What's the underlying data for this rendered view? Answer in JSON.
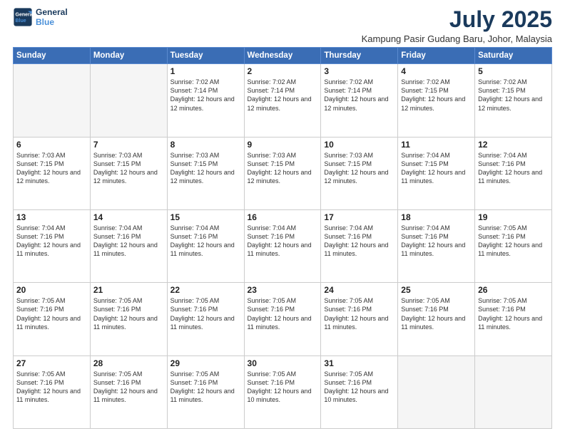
{
  "logo": {
    "line1": "General",
    "line2": "Blue"
  },
  "header": {
    "month_year": "July 2025",
    "location": "Kampung Pasir Gudang Baru, Johor, Malaysia"
  },
  "days_of_week": [
    "Sunday",
    "Monday",
    "Tuesday",
    "Wednesday",
    "Thursday",
    "Friday",
    "Saturday"
  ],
  "weeks": [
    [
      {
        "day": "",
        "info": ""
      },
      {
        "day": "",
        "info": ""
      },
      {
        "day": "1",
        "info": "Sunrise: 7:02 AM\nSunset: 7:14 PM\nDaylight: 12 hours and 12 minutes."
      },
      {
        "day": "2",
        "info": "Sunrise: 7:02 AM\nSunset: 7:14 PM\nDaylight: 12 hours and 12 minutes."
      },
      {
        "day": "3",
        "info": "Sunrise: 7:02 AM\nSunset: 7:14 PM\nDaylight: 12 hours and 12 minutes."
      },
      {
        "day": "4",
        "info": "Sunrise: 7:02 AM\nSunset: 7:15 PM\nDaylight: 12 hours and 12 minutes."
      },
      {
        "day": "5",
        "info": "Sunrise: 7:02 AM\nSunset: 7:15 PM\nDaylight: 12 hours and 12 minutes."
      }
    ],
    [
      {
        "day": "6",
        "info": "Sunrise: 7:03 AM\nSunset: 7:15 PM\nDaylight: 12 hours and 12 minutes."
      },
      {
        "day": "7",
        "info": "Sunrise: 7:03 AM\nSunset: 7:15 PM\nDaylight: 12 hours and 12 minutes."
      },
      {
        "day": "8",
        "info": "Sunrise: 7:03 AM\nSunset: 7:15 PM\nDaylight: 12 hours and 12 minutes."
      },
      {
        "day": "9",
        "info": "Sunrise: 7:03 AM\nSunset: 7:15 PM\nDaylight: 12 hours and 12 minutes."
      },
      {
        "day": "10",
        "info": "Sunrise: 7:03 AM\nSunset: 7:15 PM\nDaylight: 12 hours and 12 minutes."
      },
      {
        "day": "11",
        "info": "Sunrise: 7:04 AM\nSunset: 7:15 PM\nDaylight: 12 hours and 11 minutes."
      },
      {
        "day": "12",
        "info": "Sunrise: 7:04 AM\nSunset: 7:16 PM\nDaylight: 12 hours and 11 minutes."
      }
    ],
    [
      {
        "day": "13",
        "info": "Sunrise: 7:04 AM\nSunset: 7:16 PM\nDaylight: 12 hours and 11 minutes."
      },
      {
        "day": "14",
        "info": "Sunrise: 7:04 AM\nSunset: 7:16 PM\nDaylight: 12 hours and 11 minutes."
      },
      {
        "day": "15",
        "info": "Sunrise: 7:04 AM\nSunset: 7:16 PM\nDaylight: 12 hours and 11 minutes."
      },
      {
        "day": "16",
        "info": "Sunrise: 7:04 AM\nSunset: 7:16 PM\nDaylight: 12 hours and 11 minutes."
      },
      {
        "day": "17",
        "info": "Sunrise: 7:04 AM\nSunset: 7:16 PM\nDaylight: 12 hours and 11 minutes."
      },
      {
        "day": "18",
        "info": "Sunrise: 7:04 AM\nSunset: 7:16 PM\nDaylight: 12 hours and 11 minutes."
      },
      {
        "day": "19",
        "info": "Sunrise: 7:05 AM\nSunset: 7:16 PM\nDaylight: 12 hours and 11 minutes."
      }
    ],
    [
      {
        "day": "20",
        "info": "Sunrise: 7:05 AM\nSunset: 7:16 PM\nDaylight: 12 hours and 11 minutes."
      },
      {
        "day": "21",
        "info": "Sunrise: 7:05 AM\nSunset: 7:16 PM\nDaylight: 12 hours and 11 minutes."
      },
      {
        "day": "22",
        "info": "Sunrise: 7:05 AM\nSunset: 7:16 PM\nDaylight: 12 hours and 11 minutes."
      },
      {
        "day": "23",
        "info": "Sunrise: 7:05 AM\nSunset: 7:16 PM\nDaylight: 12 hours and 11 minutes."
      },
      {
        "day": "24",
        "info": "Sunrise: 7:05 AM\nSunset: 7:16 PM\nDaylight: 12 hours and 11 minutes."
      },
      {
        "day": "25",
        "info": "Sunrise: 7:05 AM\nSunset: 7:16 PM\nDaylight: 12 hours and 11 minutes."
      },
      {
        "day": "26",
        "info": "Sunrise: 7:05 AM\nSunset: 7:16 PM\nDaylight: 12 hours and 11 minutes."
      }
    ],
    [
      {
        "day": "27",
        "info": "Sunrise: 7:05 AM\nSunset: 7:16 PM\nDaylight: 12 hours and 11 minutes."
      },
      {
        "day": "28",
        "info": "Sunrise: 7:05 AM\nSunset: 7:16 PM\nDaylight: 12 hours and 11 minutes."
      },
      {
        "day": "29",
        "info": "Sunrise: 7:05 AM\nSunset: 7:16 PM\nDaylight: 12 hours and 11 minutes."
      },
      {
        "day": "30",
        "info": "Sunrise: 7:05 AM\nSunset: 7:16 PM\nDaylight: 12 hours and 10 minutes."
      },
      {
        "day": "31",
        "info": "Sunrise: 7:05 AM\nSunset: 7:16 PM\nDaylight: 12 hours and 10 minutes."
      },
      {
        "day": "",
        "info": ""
      },
      {
        "day": "",
        "info": ""
      }
    ]
  ]
}
